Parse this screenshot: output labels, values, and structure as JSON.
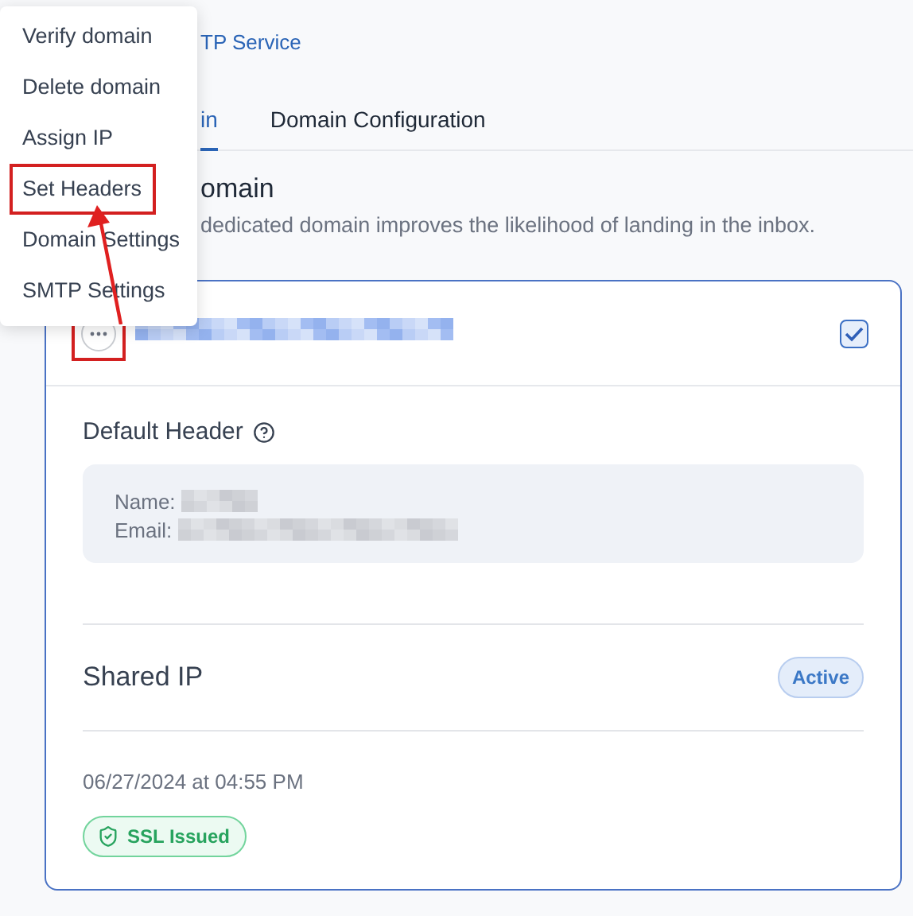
{
  "breadcrumb": "TP Service",
  "tabs": [
    {
      "label": "in",
      "selected": true
    },
    {
      "label": "Domain Configuration",
      "selected": false
    }
  ],
  "section": {
    "title": "omain",
    "description": "dedicated domain improves the likelihood of landing in the inbox."
  },
  "menu": {
    "items": [
      {
        "label": "Verify domain",
        "highlighted": false
      },
      {
        "label": "Delete domain",
        "highlighted": false
      },
      {
        "label": "Assign IP",
        "highlighted": false
      },
      {
        "label": "Set Headers",
        "highlighted": true
      },
      {
        "label": "Domain Settings",
        "highlighted": false
      },
      {
        "label": "SMTP Settings",
        "highlighted": false
      }
    ]
  },
  "domain_card": {
    "more_button_highlighted": true,
    "checked": true,
    "default_header": {
      "title": "Default Header",
      "fields": [
        {
          "label": "Name:"
        },
        {
          "label": "Email:"
        }
      ]
    },
    "ip": {
      "label": "Shared IP",
      "status": "Active"
    },
    "created": "06/27/2024 at 04:55 PM",
    "ssl_status": "SSL Issued"
  }
}
